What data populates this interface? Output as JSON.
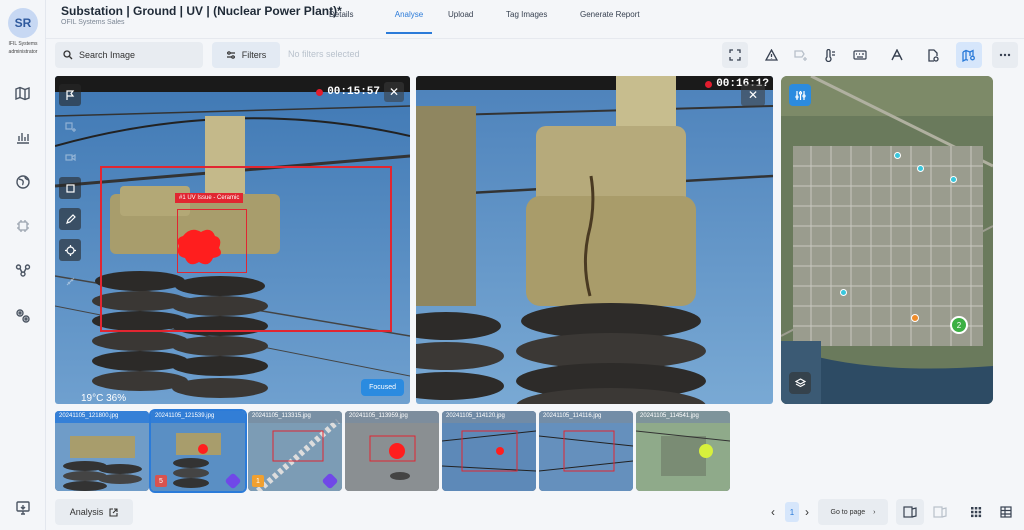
{
  "user": {
    "initials": "SR",
    "org": "IFIL Systems",
    "role": "administrator"
  },
  "header": {
    "title": "Substation | Ground | UV | (Nuclear Power Plant)*",
    "subtitle": "OFIL Systems Sales",
    "tabs": [
      {
        "label": "Details",
        "active": false
      },
      {
        "label": "Analyse",
        "active": true
      },
      {
        "label": "Upload",
        "active": false
      },
      {
        "label": "Tag Images",
        "active": false
      },
      {
        "label": "Generate Report",
        "active": false
      }
    ]
  },
  "toolbar": {
    "search_placeholder": "Search Image",
    "filters_label": "Filters",
    "no_filters": "No filters selected"
  },
  "viewer_left": {
    "timer": "00:15:57",
    "annotation_label": "#1 UV Issue - Ceramic",
    "focused_label": "Focused",
    "weather": "19°C  36%",
    "extra": "N:"
  },
  "viewer_right": {
    "timer": "00:16:1?"
  },
  "map": {
    "cluster_count": "2"
  },
  "thumbnails": [
    {
      "name": "20241105_121800.jpg",
      "selected": false,
      "badge": "",
      "badge_color": ""
    },
    {
      "name": "20241105_121539.jpg",
      "selected": true,
      "badge": "5",
      "badge_color": "#d9534f"
    },
    {
      "name": "20241105_113315.jpg",
      "selected": false,
      "badge": "1",
      "badge_color": "#f0a030"
    },
    {
      "name": "20241105_113959.jpg",
      "selected": false,
      "badge": "",
      "badge_color": ""
    },
    {
      "name": "20241105_114120.jpg",
      "selected": false,
      "badge": "",
      "badge_color": ""
    },
    {
      "name": "20241105_114116.jpg",
      "selected": false,
      "badge": "",
      "badge_color": ""
    },
    {
      "name": "20241105_114541.jpg",
      "selected": false,
      "badge": "",
      "badge_color": ""
    }
  ],
  "footer": {
    "analysis_label": "Analysis",
    "page": "1",
    "goto_label": "Go to page"
  },
  "colors": {
    "accent": "#2b7bd9",
    "alert": "#e12631"
  }
}
